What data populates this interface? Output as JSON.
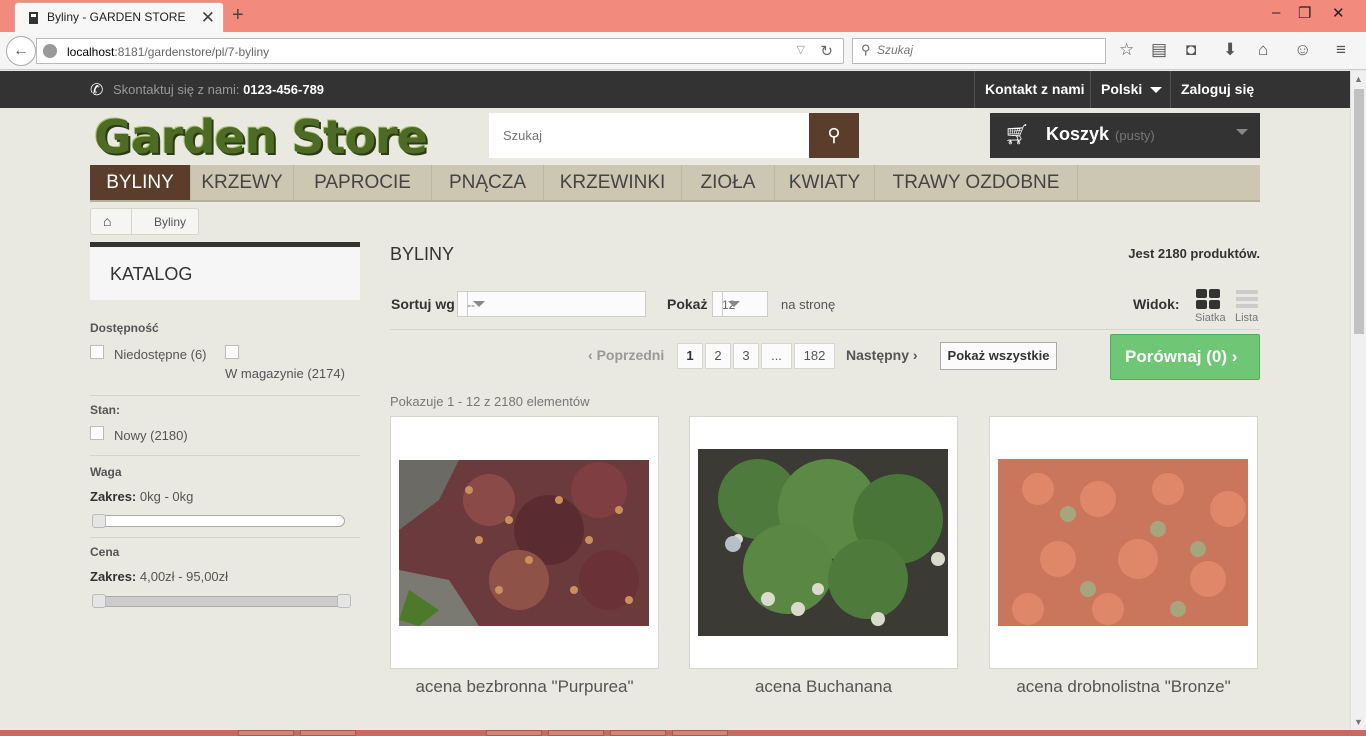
{
  "browser": {
    "tab_title": "Byliny - GARDEN STORE",
    "url_host": "localhost",
    "url_rest": ":8181/gardenstore/pl/7-byliny",
    "search_placeholder": "Szukaj"
  },
  "topbar": {
    "contact_label": "Skontaktuj się z nami:",
    "phone": "0123-456-789",
    "contact_link": "Kontakt z nami",
    "language": "Polski",
    "login": "Zaloguj się"
  },
  "header": {
    "logo": "Garden Store",
    "search_placeholder": "Szukaj",
    "cart_label": "Koszyk",
    "cart_status": "(pusty)"
  },
  "menu": [
    "BYLINY",
    "KRZEWY",
    "PAPROCIE",
    "PNĄCZA",
    "KRZEWINKI",
    "ZIOŁA",
    "KWIATY",
    "TRAWY OZDOBNE"
  ],
  "breadcrumb": {
    "current": "Byliny"
  },
  "sidebar": {
    "catalog_title": "KATALOG",
    "availability": {
      "title": "Dostępność",
      "options": [
        "Niedostępne (6)",
        "W magazynie (2174)"
      ]
    },
    "condition": {
      "title": "Stan:",
      "options": [
        "Nowy (2180)"
      ]
    },
    "weight": {
      "title": "Waga",
      "range_label": "Zakres:",
      "range_value": "0kg - 0kg"
    },
    "price": {
      "title": "Cena",
      "range_label": "Zakres:",
      "range_value": "4,00zł - 95,00zł"
    }
  },
  "content": {
    "title": "BYLINY",
    "count": "Jest 2180 produktów.",
    "sort_label": "Sortuj wg",
    "sort_value": "--",
    "show_label": "Pokaż",
    "show_value": "12",
    "per_page": "na stronę",
    "view_label": "Widok:",
    "view_grid": "Siatka",
    "view_list": "Lista",
    "prev": "Poprzedni",
    "pages": [
      "1",
      "2",
      "3",
      "...",
      "182"
    ],
    "next": "Następny",
    "show_all": "Pokaż wszystkie",
    "compare": "Porównaj (0)",
    "showing": "Pokazuje 1 - 12 z 2180 elementów"
  },
  "products": [
    {
      "name": "acena bezbronna \"Purpurea\""
    },
    {
      "name": "acena Buchanana"
    },
    {
      "name": "acena drobnolistna \"Bronze\""
    }
  ]
}
